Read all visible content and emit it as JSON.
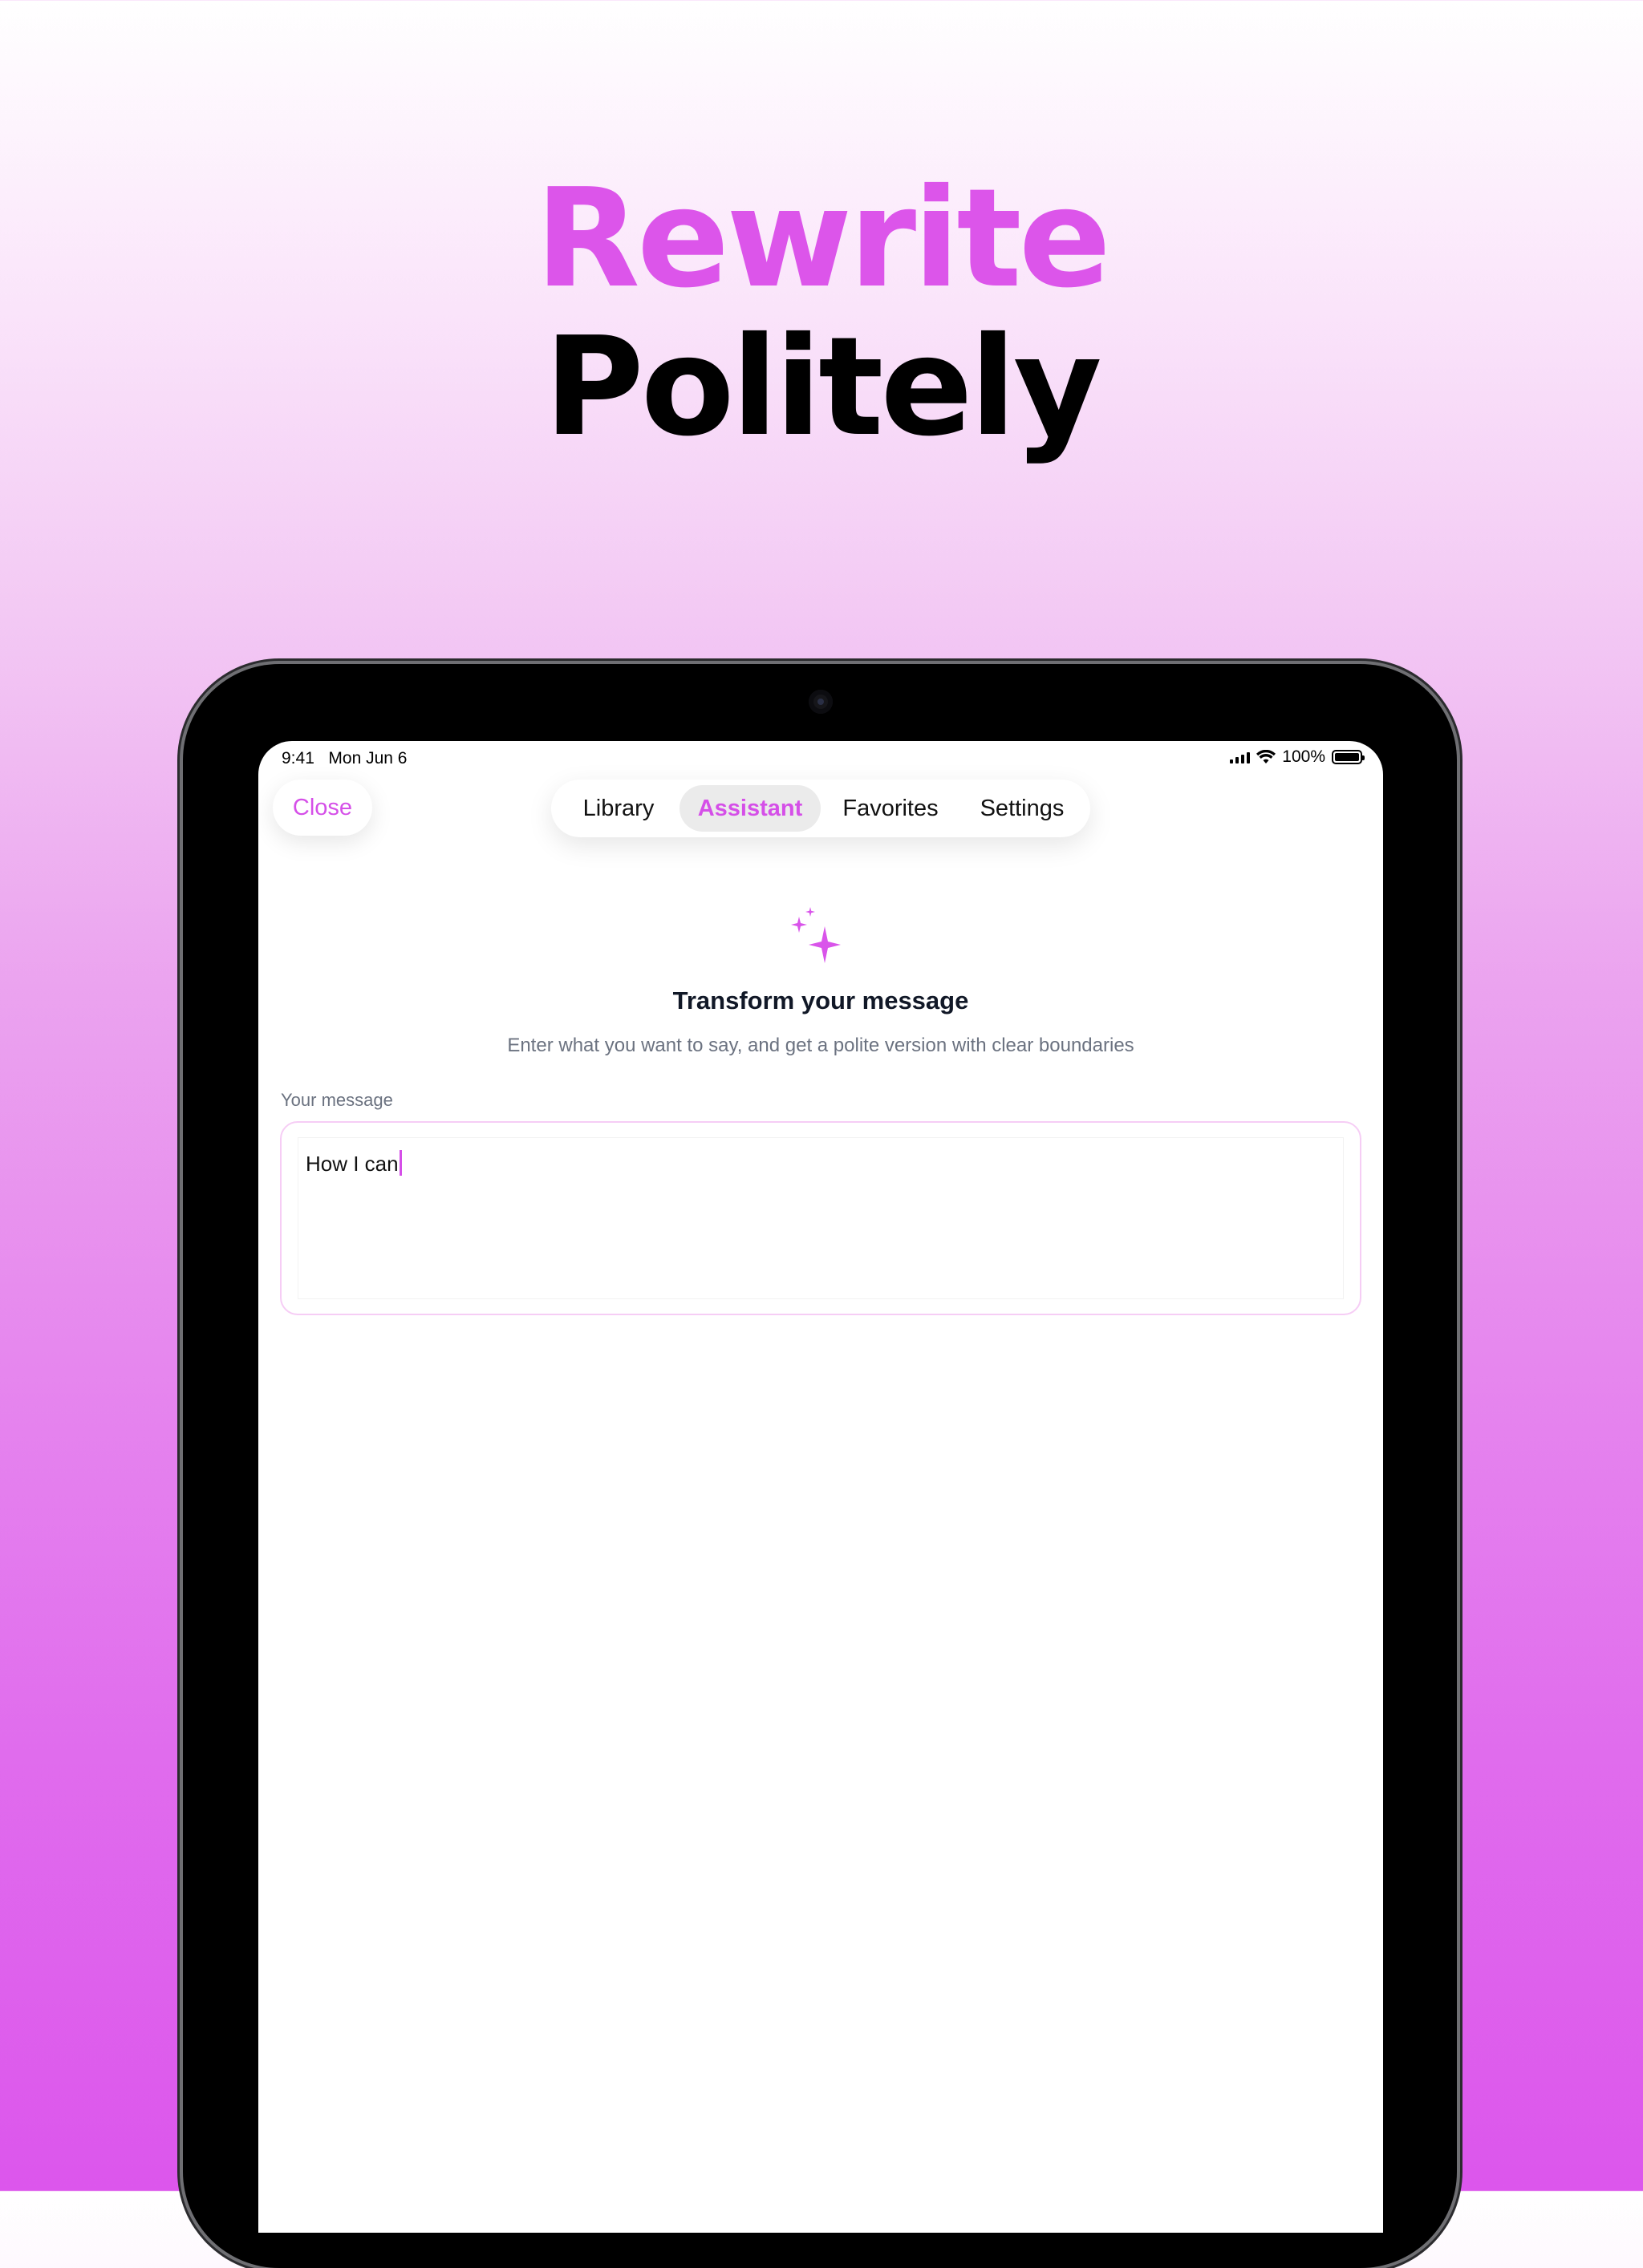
{
  "marketing": {
    "headline_line1": "Rewrite",
    "headline_line2": "Politely",
    "accent_color": "#D954EA"
  },
  "status_bar": {
    "time": "9:41",
    "date": "Mon Jun 6",
    "battery": "100%"
  },
  "nav": {
    "close_label": "Close",
    "tabs": [
      {
        "label": "Library",
        "active": false
      },
      {
        "label": "Assistant",
        "active": true
      },
      {
        "label": "Favorites",
        "active": false
      },
      {
        "label": "Settings",
        "active": false
      }
    ]
  },
  "assistant": {
    "icon": "sparkles-icon",
    "title": "Transform your message",
    "subtitle": "Enter what you want to say, and get a polite version with clear boundaries",
    "field_label": "Your message",
    "message_value": "How I can"
  }
}
